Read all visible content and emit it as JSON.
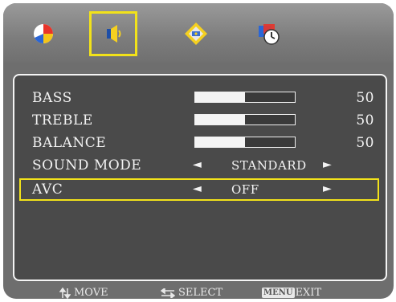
{
  "tabs": [
    {
      "name": "picture-icon",
      "active": false
    },
    {
      "name": "sound-icon",
      "active": true
    },
    {
      "name": "setup-icon",
      "active": false
    },
    {
      "name": "timer-icon",
      "active": false
    }
  ],
  "rows": [
    {
      "label": "BASS",
      "type": "slider",
      "value": "50",
      "level": 0.5
    },
    {
      "label": "TREBLE",
      "type": "slider",
      "value": "50",
      "level": 0.5
    },
    {
      "label": "BALANCE",
      "type": "slider",
      "value": "50",
      "level": 0.5
    },
    {
      "label": "SOUND MODE",
      "type": "option",
      "value": "STANDARD"
    },
    {
      "label": "AVC",
      "type": "option",
      "value": "OFF",
      "selected": true
    }
  ],
  "arrows": {
    "left": "◄",
    "right": "►"
  },
  "footer": {
    "move_label": "MOVE",
    "select_label": "SELECT",
    "menu_key": "MENU",
    "exit_label": "EXIT"
  },
  "colors": {
    "highlight": "#f2e21a",
    "panel": "#4a4a4a",
    "text": "#f3f3f3"
  }
}
